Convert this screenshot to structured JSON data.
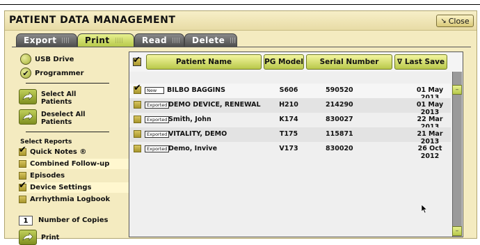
{
  "window": {
    "title": "PATIENT DATA MANAGEMENT",
    "close_label": "Close"
  },
  "tabs": [
    {
      "label": "Export",
      "active": false
    },
    {
      "label": "Print",
      "active": true
    },
    {
      "label": "Read",
      "active": false
    },
    {
      "label": "Delete",
      "active": false
    }
  ],
  "source": {
    "usb_label": "USB Drive",
    "programmer_label": "Programmer",
    "selected": "Programmer"
  },
  "actions": {
    "select_all_line1": "Select All",
    "select_all_line2": "Patients",
    "deselect_all_line1": "Deselect All",
    "deselect_all_line2": "Patients"
  },
  "reports": {
    "section_title": "Select Reports",
    "items": [
      {
        "label": "Quick Notes ®",
        "checked": true
      },
      {
        "label": "Combined Follow-up",
        "checked": false
      },
      {
        "label": "Episodes",
        "checked": false
      },
      {
        "label": "Device Settings",
        "checked": true
      },
      {
        "label": "Arrhythmia Logbook",
        "checked": false
      }
    ]
  },
  "copies": {
    "value": "1",
    "label": "Number of Copies"
  },
  "print_label": "Print",
  "table": {
    "headers": {
      "name": "Patient Name",
      "model": "PG Model",
      "serial": "Serial Number",
      "last_save": "∇ Last Save"
    },
    "rows": [
      {
        "checked": true,
        "badge": "New",
        "name": "BILBO BAGGINS",
        "model": "S606",
        "serial": "590520",
        "date": "01 May 2013"
      },
      {
        "checked": false,
        "badge": "Exported",
        "name": "DEMO DEVICE, RENEWAL",
        "model": "H210",
        "serial": "214290",
        "date": "01 May 2013"
      },
      {
        "checked": false,
        "badge": "Exported",
        "name": "Smith, John",
        "model": "K174",
        "serial": "830027",
        "date": "22 Mar 2013"
      },
      {
        "checked": false,
        "badge": "Exported",
        "name": "VITALITY, DEMO",
        "model": "T175",
        "serial": "115871",
        "date": "21 Mar 2013"
      },
      {
        "checked": false,
        "badge": "Exported",
        "name": "Demo, Invive",
        "model": "V173",
        "serial": "830020",
        "date": "26 Oct 2012"
      }
    ]
  },
  "colors": {
    "panel": "#f4ebc0",
    "accent_green": "#b7c94a",
    "tab_dark": "#4e4e4e"
  }
}
